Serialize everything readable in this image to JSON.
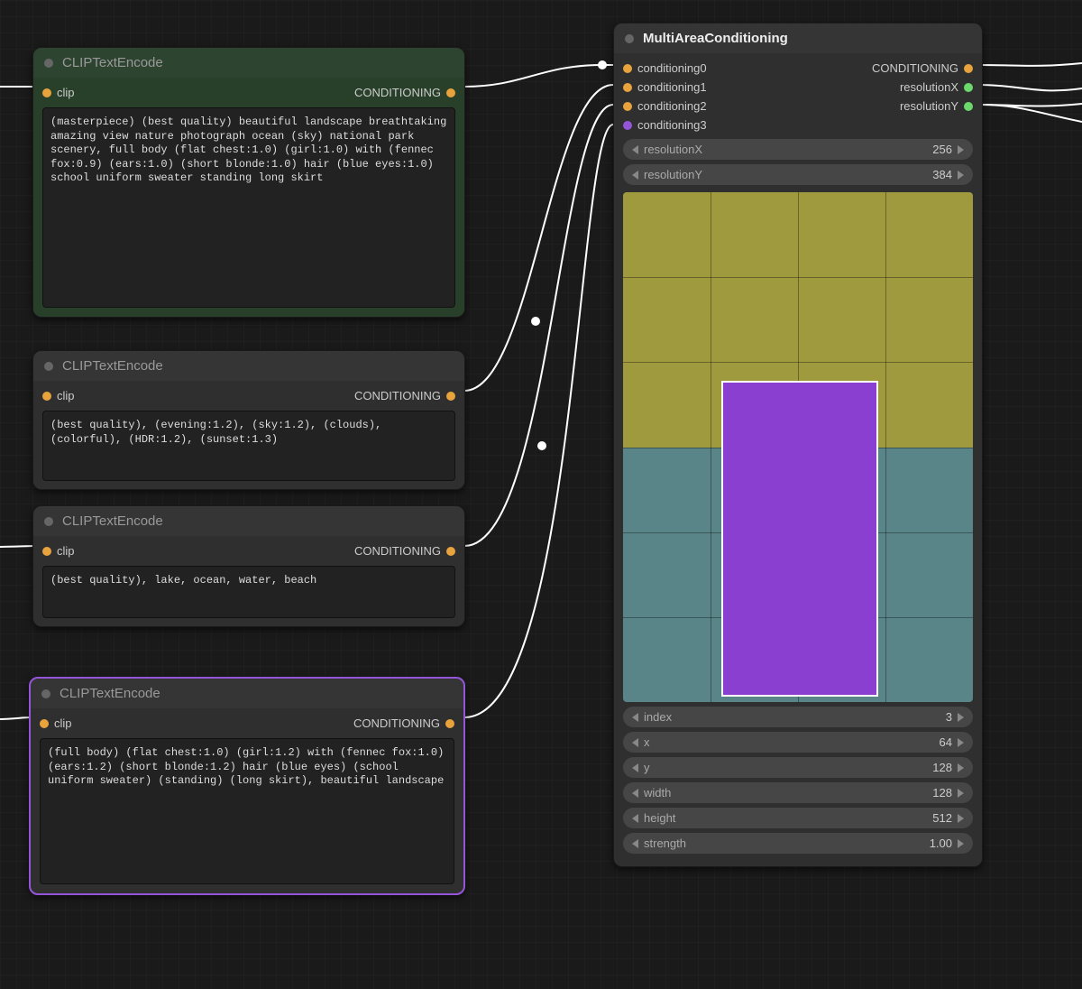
{
  "nodes": {
    "n1": {
      "title": "CLIPTextEncode",
      "input_label": "clip",
      "output_label": "CONDITIONING",
      "text": "(masterpiece) (best quality) beautiful landscape breathtaking amazing view nature photograph ocean (sky) national park scenery, full body (flat chest:1.0) (girl:1.0) with (fennec fox:0.9) (ears:1.0) (short blonde:1.0) hair (blue eyes:1.0) school uniform sweater standing long skirt"
    },
    "n2": {
      "title": "CLIPTextEncode",
      "input_label": "clip",
      "output_label": "CONDITIONING",
      "text": "(best quality), (evening:1.2), (sky:1.2), (clouds), (colorful), (HDR:1.2), (sunset:1.3)"
    },
    "n3": {
      "title": "CLIPTextEncode",
      "input_label": "clip",
      "output_label": "CONDITIONING",
      "text": "(best quality), lake, ocean, water, beach"
    },
    "n4": {
      "title": "CLIPTextEncode",
      "input_label": "clip",
      "output_label": "CONDITIONING",
      "text": "(full body) (flat chest:1.0) (girl:1.2) with (fennec fox:1.0) (ears:1.2) (short blonde:1.2) hair (blue eyes) (school uniform sweater) (standing) (long skirt), beautiful landscape"
    },
    "mac": {
      "title": "MultiAreaConditioning",
      "inputs": [
        "conditioning0",
        "conditioning1",
        "conditioning2",
        "conditioning3"
      ],
      "outputs": [
        "CONDITIONING",
        "resolutionX",
        "resolutionY"
      ],
      "resolutionX": {
        "label": "resolutionX",
        "value": "256"
      },
      "resolutionY": {
        "label": "resolutionY",
        "value": "384"
      },
      "index": {
        "label": "index",
        "value": "3"
      },
      "x": {
        "label": "x",
        "value": "64"
      },
      "y": {
        "label": "y",
        "value": "128"
      },
      "width": {
        "label": "width",
        "value": "128"
      },
      "height": {
        "label": "height",
        "value": "512"
      },
      "strength": {
        "label": "strength",
        "value": "1.00"
      }
    }
  }
}
